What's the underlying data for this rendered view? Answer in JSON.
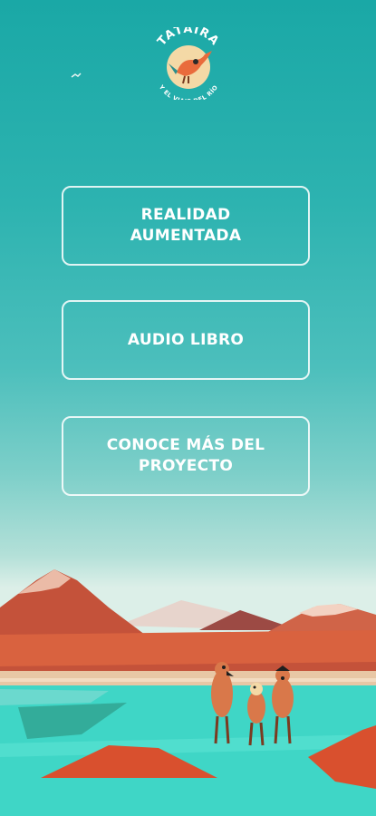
{
  "logo": {
    "title": "TATAIRA",
    "subtitle": "Y EL VIAJE DEL RÍO"
  },
  "menu": {
    "items": [
      {
        "label_line1": "REALIDAD",
        "label_line2": "AUMENTADA"
      },
      {
        "label_line1": "AUDIO LIBRO",
        "label_line2": ""
      },
      {
        "label_line1": "CONOCE MÁS DEL",
        "label_line2": "PROYECTO"
      }
    ]
  },
  "colors": {
    "sky_top": "#1aa8a6",
    "mountain": "#c4523a",
    "water": "#3fd6c6",
    "button_border": "#ffffff"
  }
}
